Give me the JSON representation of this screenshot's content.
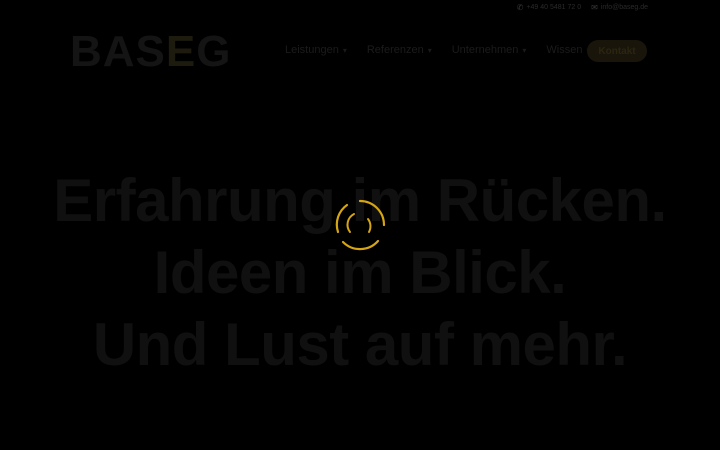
{
  "topbar": {
    "phone": "+49 40 5481 72 0",
    "email": "info@baseg.de"
  },
  "logo": {
    "text_left": "BAS",
    "text_mark": "E",
    "text_right": "G"
  },
  "nav": {
    "items": [
      {
        "label": "Leistungen"
      },
      {
        "label": "Referenzen"
      },
      {
        "label": "Unternehmen"
      },
      {
        "label": "Wissen"
      }
    ]
  },
  "cta": {
    "label": "Kontakt"
  },
  "hero": {
    "line1": "Erfahrung im Rücken.",
    "line2": "Ideen im Blick.",
    "line3": "Und Lust auf mehr."
  },
  "colors": {
    "accent": "#d4a514",
    "overlay": "#000000"
  },
  "icons": {
    "phone": "phone-icon",
    "email": "mail-icon",
    "loader": "loading-spinner"
  }
}
